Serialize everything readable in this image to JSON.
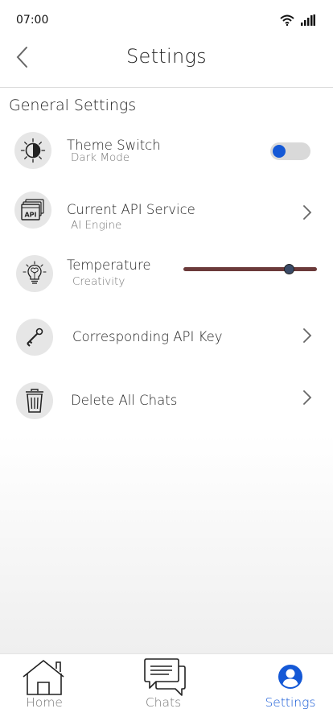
{
  "status_bar": {
    "time": "07:00",
    "wifi_icon": "wifi-icon",
    "signal_icon": "cellular-signal-icon"
  },
  "header": {
    "title": "Settings",
    "back_icon": "chevron-left-icon"
  },
  "section": {
    "title": "General Settings"
  },
  "settings": {
    "theme": {
      "title": "Theme Switch",
      "subtitle": "Dark Mode",
      "icon": "brightness-icon",
      "toggle_on": false
    },
    "api_service": {
      "title": "Current API Service",
      "subtitle": "AI Engine",
      "icon": "api-icon"
    },
    "temperature": {
      "title": "Temperature",
      "subtitle": "Creativity",
      "icon": "lightbulb-icon",
      "value": 0.82
    },
    "api_key": {
      "title": "Corresponding API Key",
      "icon": "key-icon"
    },
    "delete_chats": {
      "title": "Delete All Chats",
      "icon": "trash-icon"
    }
  },
  "tabs": [
    {
      "label": "Home",
      "icon": "home-icon",
      "active": false
    },
    {
      "label": "Chats",
      "icon": "chat-bubbles-icon",
      "active": false
    },
    {
      "label": "Settings",
      "icon": "user-circle-icon",
      "active": true
    }
  ],
  "colors": {
    "accent": "#1458d6",
    "inactive": "#777777",
    "slider_track": "#6b3a3a"
  }
}
